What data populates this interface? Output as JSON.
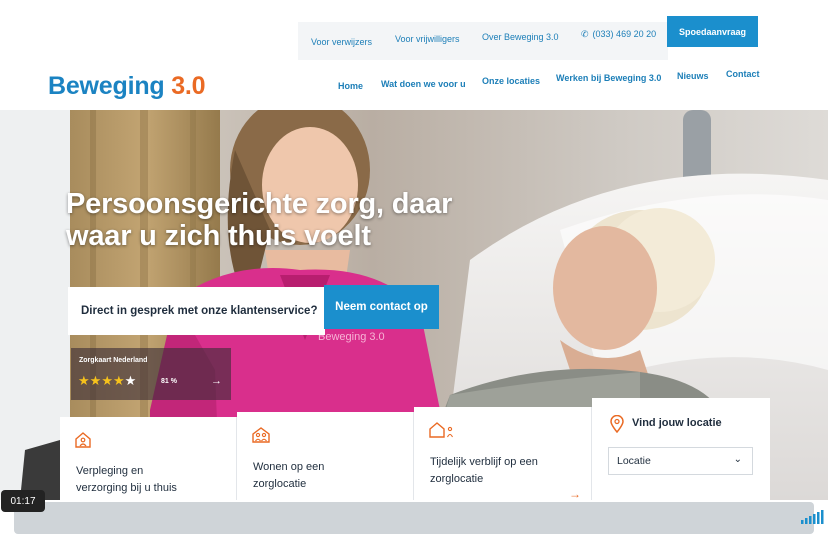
{
  "header": {
    "top_links": [
      "Voor verwijzers",
      "Voor vrijwilligers",
      "Over Beweging 3.0"
    ],
    "phone": "(033) 469 20 20",
    "urgent_button": "Spoedaanvraag",
    "logo_word": "Beweging",
    "logo_version": "3.0",
    "nav": [
      "Home",
      "Wat doen we voor u",
      "Onze locaties",
      "Werken bij Beweging 3.0",
      "Nieuws",
      "Contact"
    ]
  },
  "hero": {
    "headline_line1": "Persoonsgerichte zorg, daar",
    "headline_line2": "waar u zich thuis voelt",
    "uniform_logo": "Beweging 3.0",
    "customer_service_text": "Direct in gesprek met onze klantenservice?",
    "contact_button": "Neem contact op",
    "rating": {
      "source": "Zorgkaart Nederland",
      "stars_filled": 4,
      "stars_total": 5,
      "score": "81 %"
    }
  },
  "cards": [
    {
      "line1": "Verpleging en",
      "line2": "verzorging bij u thuis",
      "icon": "house-person-icon"
    },
    {
      "line1": "Wonen op een",
      "line2": "zorglocatie",
      "icon": "house-people-icon"
    },
    {
      "line1": "Tijdelijk verblijf op een",
      "line2": "zorglocatie",
      "icon": "house-temporary-icon"
    }
  ],
  "location": {
    "title": "Vind jouw locatie",
    "select_value": "Locatie",
    "icon": "map-pin-icon"
  },
  "video": {
    "timecode": "01:17",
    "progress": 0.0
  },
  "colors": {
    "brand_blue": "#1b8fcd",
    "brand_orange": "#ea6a24",
    "navy_text": "#1f2d3d"
  }
}
